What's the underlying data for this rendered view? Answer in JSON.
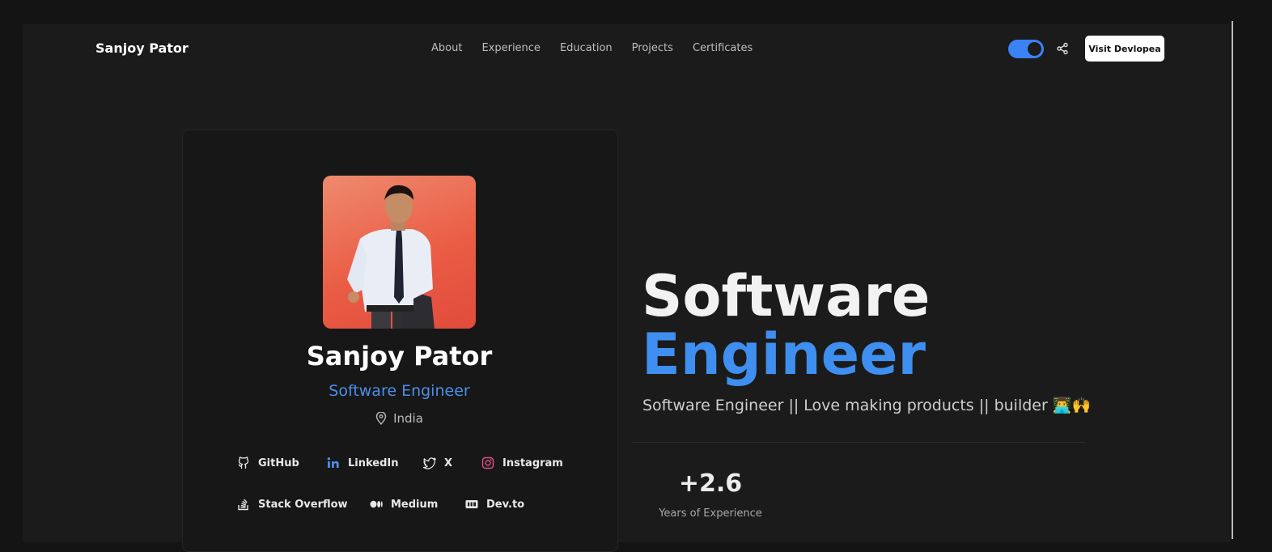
{
  "header": {
    "brand": "Sanjoy Pator",
    "nav": [
      "About",
      "Experience",
      "Education",
      "Projects",
      "Certificates"
    ],
    "theme_toggle_on": true,
    "cta_label": "Visit Devlopea"
  },
  "colors": {
    "accent": "#3f8ff0",
    "background": "#1b1b1b",
    "card": "#171717"
  },
  "profile": {
    "name": "Sanjoy Pator",
    "role": "Software Engineer",
    "location": "India",
    "socials": [
      {
        "label": "GitHub",
        "icon": "github-icon"
      },
      {
        "label": "LinkedIn",
        "icon": "linkedin-icon"
      },
      {
        "label": "X",
        "icon": "twitter-icon"
      },
      {
        "label": "Instagram",
        "icon": "instagram-icon"
      },
      {
        "label": "Stack Overflow",
        "icon": "stackoverflow-icon"
      },
      {
        "label": "Medium",
        "icon": "medium-icon"
      },
      {
        "label": "Dev.to",
        "icon": "devto-icon"
      }
    ]
  },
  "hero": {
    "title_line1": "Software",
    "title_line2": "Engineer",
    "tagline": "Software Engineer || Love making products || builder 👨‍💻🙌"
  },
  "stats": {
    "value": "+2.6",
    "label": "Years of Experience"
  }
}
